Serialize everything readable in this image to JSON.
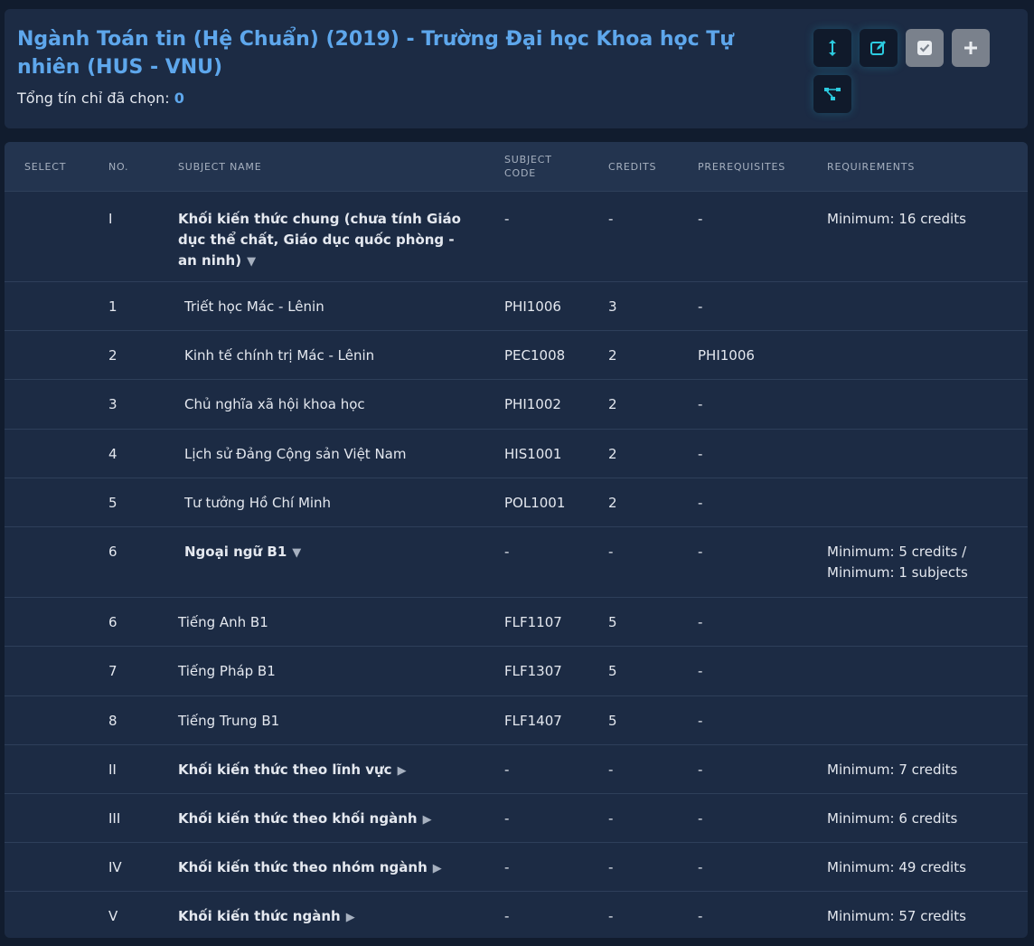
{
  "header": {
    "title": "Ngành Toán tin (Hệ Chuẩn) (2019) - Trường Đại học Khoa học Tự nhiên (HUS - VNU)",
    "total_label": "Tổng tín chỉ đã chọn:",
    "total_value": "0"
  },
  "toolbar": [
    {
      "name": "expand-collapse-button",
      "icon": "vertical-arrows-icon"
    },
    {
      "name": "edit-button",
      "icon": "edit-icon"
    },
    {
      "name": "select-all-button",
      "icon": "checkbox-icon"
    },
    {
      "name": "add-button",
      "icon": "plus-icon"
    },
    {
      "name": "tree-view-button",
      "icon": "hierarchy-icon"
    }
  ],
  "columns": {
    "select": "SELECT",
    "no": "NO.",
    "name": "SUBJECT NAME",
    "code_line1": "SUBJECT",
    "code_line2": "CODE",
    "credits": "CREDITS",
    "prereq": "PREREQUISITES",
    "requirements": "REQUIREMENTS"
  },
  "rows": [
    {
      "no": "I",
      "name": "Khối kiến thức chung (chưa tính Giáo dục thể chất, Giáo dục quốc phòng - an ninh)",
      "caret": "▼",
      "code": "-",
      "credits": "-",
      "prereq": "-",
      "req": "Minimum: 16 credits",
      "bold": true
    },
    {
      "no": "1",
      "name": "Triết học Mác - Lênin",
      "caret": "",
      "code": "PHI1006",
      "credits": "3",
      "prereq": "-",
      "req": "",
      "bold": false
    },
    {
      "no": "2",
      "name": "Kinh tế chính trị Mác - Lênin",
      "caret": "",
      "code": "PEC1008",
      "credits": "2",
      "prereq": "PHI1006",
      "req": "",
      "bold": false
    },
    {
      "no": "3",
      "name": "Chủ nghĩa xã hội khoa học",
      "caret": "",
      "code": "PHI1002",
      "credits": "2",
      "prereq": "-",
      "req": "",
      "bold": false
    },
    {
      "no": "4",
      "name": "Lịch sử Đảng Cộng sản Việt Nam",
      "caret": "",
      "code": "HIS1001",
      "credits": "2",
      "prereq": "-",
      "req": "",
      "bold": false
    },
    {
      "no": "5",
      "name": "Tư tưởng Hồ Chí Minh",
      "caret": "",
      "code": "POL1001",
      "credits": "2",
      "prereq": "-",
      "req": "",
      "bold": false
    },
    {
      "no": "6",
      "name": "Ngoại ngữ B1",
      "caret": "▼",
      "code": "-",
      "credits": "-",
      "prereq": "-",
      "req": "Minimum: 5 credits / Minimum: 1 subjects",
      "bold": true
    },
    {
      "no": "6",
      "name": "Tiếng Anh B1",
      "caret": "",
      "code": "FLF1107",
      "credits": "5",
      "prereq": "-",
      "req": "",
      "bold": false
    },
    {
      "no": "7",
      "name": "Tiếng Pháp B1",
      "caret": "",
      "code": "FLF1307",
      "credits": "5",
      "prereq": "-",
      "req": "",
      "bold": false
    },
    {
      "no": "8",
      "name": "Tiếng Trung B1",
      "caret": "",
      "code": "FLF1407",
      "credits": "5",
      "prereq": "-",
      "req": "",
      "bold": false
    },
    {
      "no": "II",
      "name": "Khối kiến thức theo lĩnh vực",
      "caret": "▶",
      "code": "-",
      "credits": "-",
      "prereq": "-",
      "req": "Minimum: 7 credits",
      "bold": true
    },
    {
      "no": "III",
      "name": "Khối kiến thức theo khối ngành",
      "caret": "▶",
      "code": "-",
      "credits": "-",
      "prereq": "-",
      "req": "Minimum: 6 credits",
      "bold": true
    },
    {
      "no": "IV",
      "name": "Khối kiến thức theo nhóm ngành",
      "caret": "▶",
      "code": "-",
      "credits": "-",
      "prereq": "-",
      "req": "Minimum: 49 credits",
      "bold": true
    },
    {
      "no": "V",
      "name": "Khối kiến thức ngành",
      "caret": "▶",
      "code": "-",
      "credits": "-",
      "prereq": "-",
      "req": "Minimum: 57 credits",
      "bold": true
    }
  ]
}
